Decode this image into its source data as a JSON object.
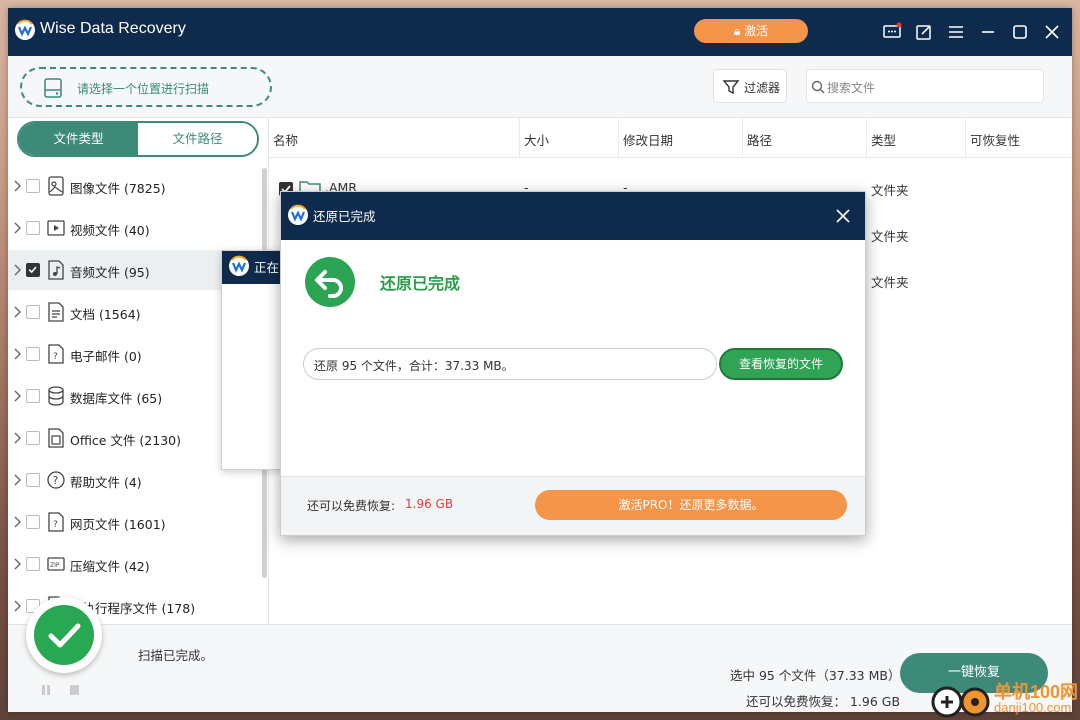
{
  "app": {
    "title": "Wise Data Recovery",
    "activate_label": "激活"
  },
  "toolbar": {
    "location_label": "请选择一个位置进行扫描",
    "filter_label": "过滤器",
    "search_placeholder": "搜索文件"
  },
  "sidebar": {
    "tabs": [
      "文件类型",
      "文件路径"
    ],
    "categories": [
      {
        "label": "图像文件 (7825)",
        "icon": "image-icon",
        "checked": false
      },
      {
        "label": "视频文件 (40)",
        "icon": "video-icon",
        "checked": false
      },
      {
        "label": "音频文件 (95)",
        "icon": "audio-icon",
        "checked": true
      },
      {
        "label": "文档 (1564)",
        "icon": "document-icon",
        "checked": false
      },
      {
        "label": "电子邮件 (0)",
        "icon": "email-icon",
        "checked": false
      },
      {
        "label": "数据库文件 (65)",
        "icon": "database-icon",
        "checked": false
      },
      {
        "label": "Office 文件 (2130)",
        "icon": "office-icon",
        "checked": false
      },
      {
        "label": "帮助文件 (4)",
        "icon": "help-icon",
        "checked": false
      },
      {
        "label": "网页文件 (1601)",
        "icon": "web-icon",
        "checked": false
      },
      {
        "label": "压缩文件 (42)",
        "icon": "zip-icon",
        "checked": false
      },
      {
        "label": "可执行程序文件 (178)",
        "icon": "executable-icon",
        "checked": false
      }
    ]
  },
  "table": {
    "columns": [
      "名称",
      "大小",
      "修改日期",
      "路径",
      "类型",
      "可恢复性"
    ],
    "rows": [
      {
        "name": ".AMR",
        "size": "-",
        "date": "-",
        "path": "",
        "type": "文件夹",
        "recoverability": ""
      },
      {
        "name": "",
        "size": "",
        "date": "",
        "path": "",
        "type": "文件夹",
        "recoverability": ""
      },
      {
        "name": "",
        "size": "",
        "date": "",
        "path": "",
        "type": "文件夹",
        "recoverability": ""
      }
    ]
  },
  "bottom": {
    "status": "扫描已完成。",
    "selected": "选中 95 个文件（37.33 MB）",
    "free_recover": "还可以免费恢复：  1.96 GB",
    "recover_button": "一键恢复"
  },
  "bg_dialog": {
    "title": "正在"
  },
  "dialog": {
    "title": "还原已完成",
    "heading": "还原已完成",
    "info": "还原 95 个文件，合计：37.33 MB。",
    "view_button": "查看恢复的文件",
    "free_label": "还可以免费恢复:",
    "free_value": "1.96 GB",
    "pro_button": "激活PRO！还原更多数据。"
  },
  "watermark": {
    "line1": "单机100网",
    "line2": "danji100.com"
  },
  "colors": {
    "titlebar": "#0e2a4c",
    "accent": "#3d8a79",
    "orange": "#f5954a",
    "green": "#2ba553",
    "red": "#e23b3b"
  }
}
